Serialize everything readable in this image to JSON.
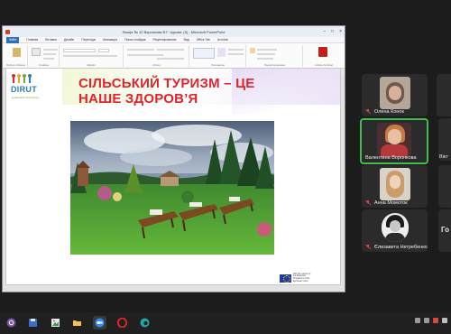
{
  "window": {
    "title": "Лекція № 12 Воронкова В.Г. туризм. (5) - Microsoft PowerPoint",
    "menu": [
      "Файл",
      "Главная",
      "Вставка",
      "Дизайн",
      "Переходы",
      "Анимация",
      "Показ слайдов",
      "Рецензирование",
      "Вид",
      "Office Tab",
      "Acrobat"
    ],
    "ribbon_groups": [
      "Буфер обмена",
      "Слайды",
      "Шрифт",
      "Абзац",
      "Рисование",
      "Редактирование",
      "Adobe Acrobat"
    ],
    "doc_tab": "Лекція № 12 Воронкова В.Г. туризм. (5)"
  },
  "slide": {
    "logo": "DIRUT",
    "logo_subtitle": "sustainable rural tourism",
    "title_line1": "СІЛЬСЬКИЙ ТУРИЗМ – ЦЕ",
    "title_line2": "НАШЕ ЗДОРОВ’Я",
    "eu_note": "With the support of the Erasmus+ Programme of the European Union"
  },
  "participants": [
    {
      "name": "Олена Конок",
      "active": false
    },
    {
      "name": "Валентина Воронкова",
      "active": true
    },
    {
      "name": "Анна Момоток",
      "active": false
    },
    {
      "name": "Єлизавета Нетребенко",
      "active": false
    }
  ],
  "edge_names": [
    "Вікт",
    "Го"
  ],
  "colors": {
    "title_red": "#e0242b",
    "logo_blue": "#2a7fb5",
    "active_speaker": "#3fbe4d",
    "taskbar": "#202020"
  },
  "taskbar_icons": [
    "viber-icon",
    "save-icon",
    "photos-icon",
    "folder-icon",
    "zoom-icon",
    "opera-icon",
    "edge-icon"
  ]
}
